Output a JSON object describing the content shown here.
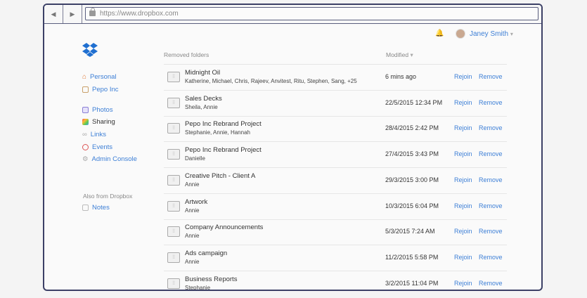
{
  "browser": {
    "url": "https://www.dropbox.com",
    "back": "◀",
    "forward": "▶"
  },
  "header": {
    "user_name": "Janey Smith",
    "caret": "▾",
    "bell": "🔔"
  },
  "sidebar": {
    "items": [
      {
        "label": "Personal",
        "icon": "⌂",
        "color": "#e07b39"
      },
      {
        "label": "Pepo Inc",
        "icon": "",
        "color": "#c9a06a"
      },
      {
        "label": "Photos",
        "icon": "",
        "color": "#8a7fd6"
      },
      {
        "label": "Sharing",
        "icon": "◔",
        "color": "#e55"
      },
      {
        "label": "Links",
        "icon": "∞",
        "color": "#aaa"
      },
      {
        "label": "Events",
        "icon": "‹",
        "color": "#d55"
      },
      {
        "label": "Admin Console",
        "icon": "⚙",
        "color": "#aaa"
      }
    ],
    "also_label": "Also from Dropbox",
    "notes_label": "Notes"
  },
  "table": {
    "col_name": "Removed folders",
    "col_modified": "Modified",
    "sort_caret": "▾",
    "rejoin": "Rejoin",
    "remove": "Remove",
    "rows": [
      {
        "name": "Midnight Oil",
        "members": "Katherine, Michael, Chris, Rajeev, Anvitest, Ritu, Stephen, Sang, +25",
        "modified": "6 mins ago"
      },
      {
        "name": "Sales Decks",
        "members": "Sheila, Annie",
        "modified": "22/5/2015 12:34 PM"
      },
      {
        "name": "Pepo Inc Rebrand Project",
        "members": "Stephanie, Annie, Hannah",
        "modified": "28/4/2015 2:42 PM"
      },
      {
        "name": "Pepo Inc Rebrand Project",
        "members": "Danielle",
        "modified": "27/4/2015 3:43 PM"
      },
      {
        "name": "Creative Pitch - Client A",
        "members": "Annie",
        "modified": "29/3/2015 3:00 PM"
      },
      {
        "name": "Artwork",
        "members": "Annie",
        "modified": "10/3/2015 6:04 PM"
      },
      {
        "name": "Company Announcements",
        "members": "Annie",
        "modified": "5/3/2015 7:24 AM"
      },
      {
        "name": "Ads campaign",
        "members": "Annie",
        "modified": "11/2/2015 5:58 PM"
      },
      {
        "name": "Business Reports",
        "members": "Stephanie",
        "modified": "3/2/2015 11:04 PM"
      }
    ]
  }
}
